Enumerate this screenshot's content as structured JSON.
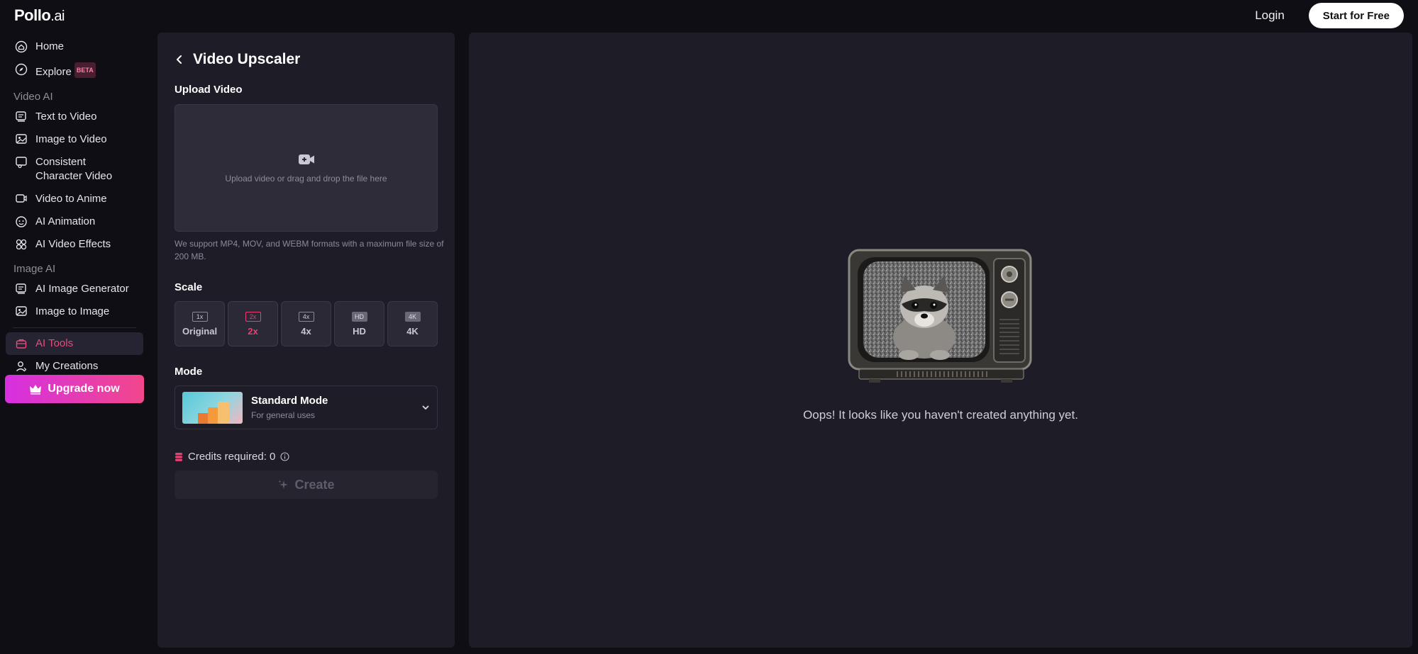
{
  "header": {
    "logo_main": "Pollo",
    "logo_suffix": ".ai",
    "login": "Login",
    "start_free": "Start for Free"
  },
  "sidebar": {
    "home": "Home",
    "explore": "Explore",
    "explore_badge": "BETA",
    "video_ai_title": "Video AI",
    "text_to_video": "Text to Video",
    "image_to_video": "Image to Video",
    "consistent_1": "Consistent",
    "consistent_2": "Character Video",
    "video_to_anime": "Video to Anime",
    "ai_animation": "AI Animation",
    "ai_video_effects": "AI Video Effects",
    "image_ai_title": "Image AI",
    "ai_image_generator": "AI Image Generator",
    "image_to_image": "Image to Image",
    "ai_tools": "AI Tools",
    "my_creations": "My Creations",
    "upgrade": "Upgrade now"
  },
  "panel": {
    "title": "Video Upscaler",
    "upload_label": "Upload Video",
    "upload_text": "Upload video or drag and drop the file here",
    "help_text": "We support MP4, MOV, and WEBM formats with a maximum file size of 200 MB.",
    "scale_label": "Scale",
    "scale_options": [
      {
        "chip": "1x",
        "label": "Original"
      },
      {
        "chip": "2x",
        "label": "2x"
      },
      {
        "chip": "4x",
        "label": "4x"
      },
      {
        "chip": "HD",
        "label": "HD"
      },
      {
        "chip": "4K",
        "label": "4K"
      }
    ],
    "selected_scale": "2x",
    "mode_label": "Mode",
    "mode_title": "Standard Mode",
    "mode_sub": "For general uses",
    "credits": "Credits required: 0",
    "create": "Create"
  },
  "canvas": {
    "empty_text": "Oops! It looks like you haven't created anything yet."
  },
  "colors": {
    "accent": "#ef3c72",
    "panel_bg": "#1e1d27",
    "page_bg": "#0f0e14"
  }
}
